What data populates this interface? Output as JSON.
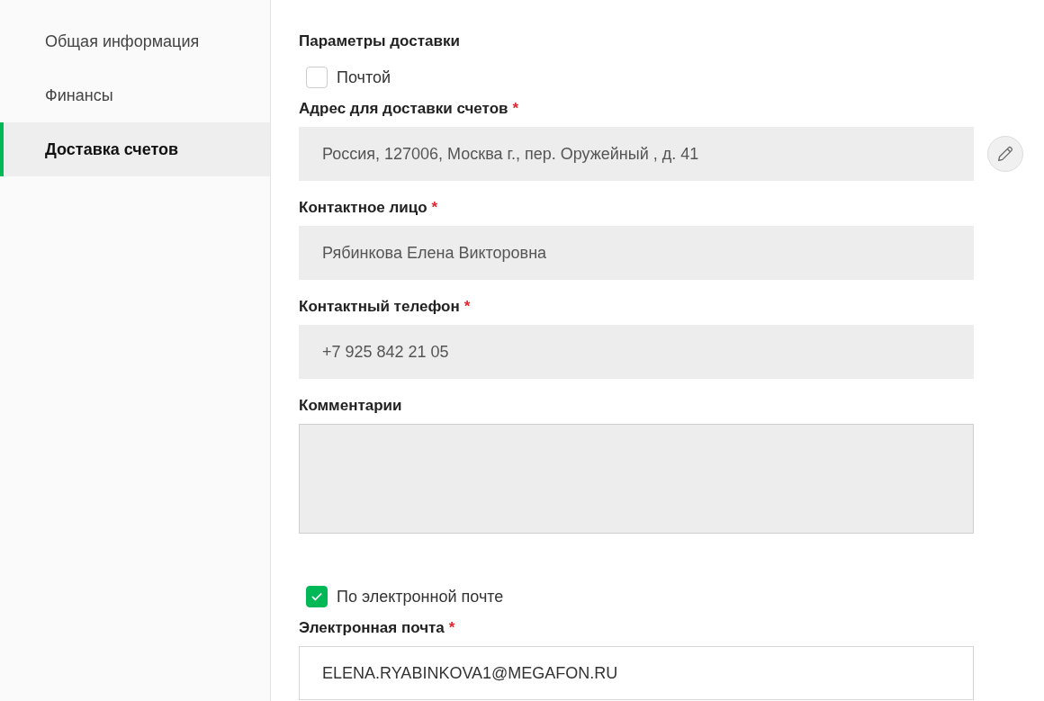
{
  "sidebar": {
    "items": [
      {
        "label": "Общая информация",
        "selected": false
      },
      {
        "label": "Финансы",
        "selected": false
      },
      {
        "label": "Доставка счетов",
        "selected": true
      }
    ]
  },
  "form": {
    "title": "Параметры доставки",
    "items": [
      {
        "kind": "checkbox",
        "label": "Почтой",
        "checked": false
      },
      {
        "kind": "field",
        "label": "Адрес для доставки счетов",
        "required_mark": "*",
        "value": "Россия, 127006, Москва г., пер. Оружейный , д. 41",
        "disabled": true,
        "editable": true
      },
      {
        "kind": "field",
        "label": "Контактное лицо",
        "required_mark": "*",
        "value": "Рябинкова Елена Викторовна",
        "disabled": true
      },
      {
        "kind": "field",
        "label": "Контактный телефон",
        "required_mark": "*",
        "value": "+7 925 842 21 05",
        "disabled": true
      },
      {
        "kind": "textarea",
        "label": "Комментарии",
        "disabled": true
      },
      {
        "kind": "checkbox",
        "label": "По электронной почте",
        "checked": true
      },
      {
        "kind": "field",
        "label": "Электронная почта",
        "required_mark": "*",
        "value": "ELENA.RYABINKOVA1@MEGAFON.RU",
        "disabled": false
      }
    ]
  }
}
